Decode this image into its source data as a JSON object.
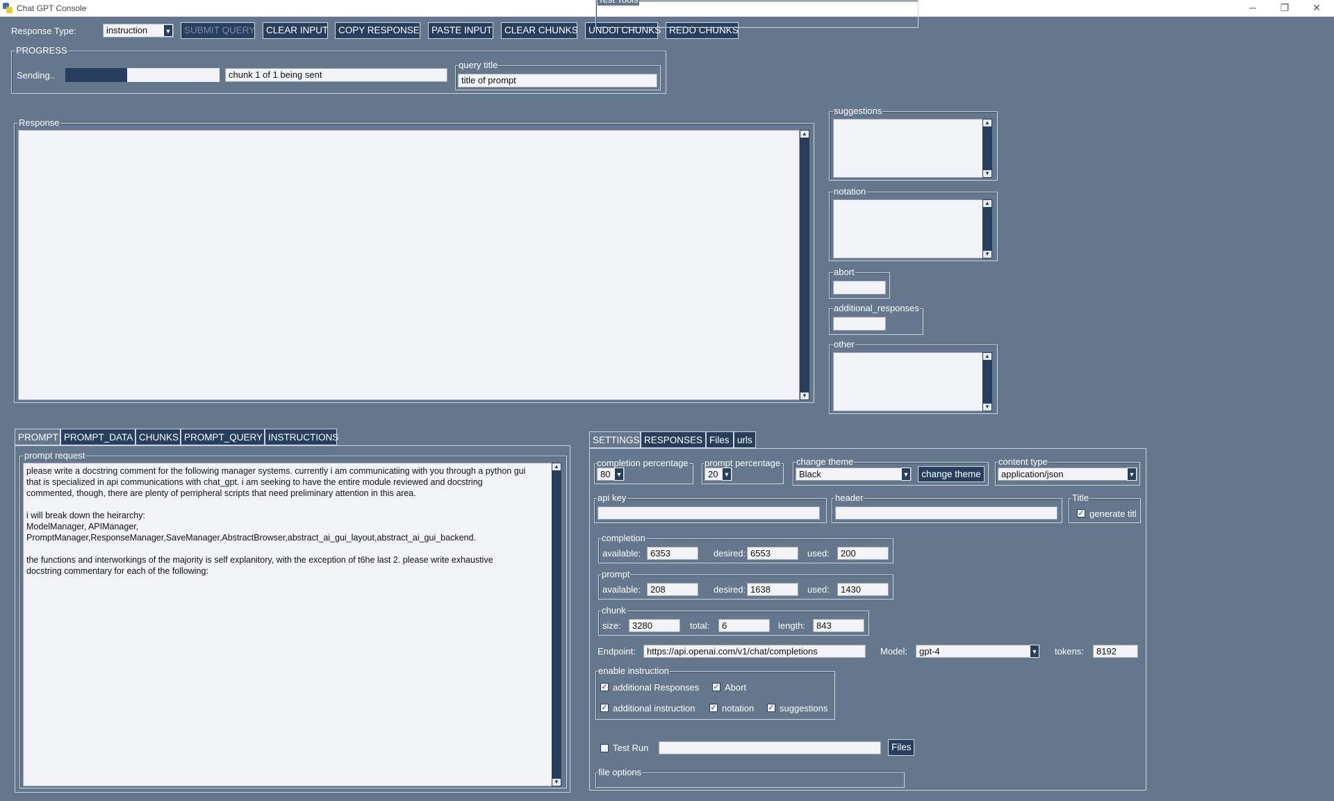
{
  "window": {
    "title": "Chat GPT Console",
    "min": "─",
    "max": "❐",
    "close": "✕"
  },
  "toolbar": {
    "response_type_label": "Response Type:",
    "response_type_value": "instruction",
    "submit": "SUBMIT QUERY",
    "clear_input": "CLEAR INPUT",
    "copy_response": "COPY RESPONSE",
    "paste_input": "PASTE INPUT",
    "clear_chunks": "CLEAR CHUNKS",
    "undo_chunks": "UNDOI CHUNKS",
    "redo_chunks": "REDO CHUNKS"
  },
  "progress": {
    "legend": "PROGRESS",
    "status": "Sending..",
    "fraction": 0.4,
    "chunk_text": "chunk 1 of 1 being sent",
    "query_title_legend": "query title",
    "query_title_value": "title of prompt"
  },
  "response": {
    "legend": "Response",
    "text": ""
  },
  "side": {
    "suggestions": "suggestions",
    "notation": "notation",
    "abort": "abort",
    "additional_responses": "additional_responses",
    "other": "other"
  },
  "left_tabs": [
    "PROMPT",
    "PROMPT_DATA",
    "CHUNKS",
    "PROMPT_QUERY",
    "INSTRUCTIONS"
  ],
  "prompt": {
    "legend": "prompt request",
    "lines": [
      "please write a docstring comment for the following manager systems. currently i am communicatiing with you through a python gui",
      "that is specialized in api communications with chat_gpt. i am seeking to have the entire module reviewed and docstring",
      "commented, though, there are plenty of perripheral scripts that need preliminary attention in this area.",
      "",
      "i will break down the heirarchy:",
      "ModelManager, APIManager,",
      "PromptManager,ResponseManager,SaveManager,AbstractBrowser,abstract_ai_gui_layout,abstract_ai_gui_backend.",
      "",
      "the functions and interworkings of the majority is self explanitory, with the exception of t6he last 2. please write exhaustive",
      "docstring commentary for each of the following:"
    ]
  },
  "right_tabs": [
    "SETTINGS",
    "RESPONSES",
    "Files",
    "urls"
  ],
  "settings": {
    "completion_percentage": {
      "legend": "completion percentage",
      "value": "80"
    },
    "prompt_percentage": {
      "legend": "prompt percentage",
      "value": "20"
    },
    "change_theme": {
      "legend": "change theme",
      "value": "Black",
      "button": "change theme"
    },
    "content_type": {
      "legend": "content type",
      "value": "application/json"
    },
    "api_key": {
      "legend": "api key",
      "value": ""
    },
    "header": {
      "legend": "header",
      "value": ""
    },
    "title": {
      "legend": "Title",
      "checkbox": "generate titl"
    },
    "completion": {
      "legend": "completion",
      "available_label": "available:",
      "available": "6353",
      "desired_label": "desired:",
      "desired": "6553",
      "used_label": "used:",
      "used": "200"
    },
    "prompt": {
      "legend": "prompt",
      "available_label": "available:",
      "available": "208",
      "desired_label": "desired:",
      "desired": "1638",
      "used_label": "used:",
      "used": "1430"
    },
    "chunk": {
      "legend": "chunk",
      "size_label": "size:",
      "size": "3280",
      "total_label": "total:",
      "total": "6",
      "length_label": "length:",
      "length": "843"
    },
    "endpoint_label": "Endpoint:",
    "endpoint": "https://api.openai.com/v1/chat/completions",
    "model_label": "Model:",
    "model": "gpt-4",
    "tokens_label": "tokens:",
    "tokens": "8192",
    "enable_instruction": {
      "legend": "enable instruction",
      "additional_responses": "additional Responses",
      "abort": "Abort",
      "additional_instruction": "additional instruction",
      "notation": "notation",
      "suggestions": "suggestions"
    },
    "test_tools": {
      "legend": "Test Tools",
      "test_run": "Test Run",
      "path": "",
      "files_button": "Files"
    },
    "file_options": {
      "legend": "file options"
    }
  },
  "colors": {
    "background": "#64778d",
    "dark": "#283e5e",
    "field": "#f1f3f6"
  }
}
